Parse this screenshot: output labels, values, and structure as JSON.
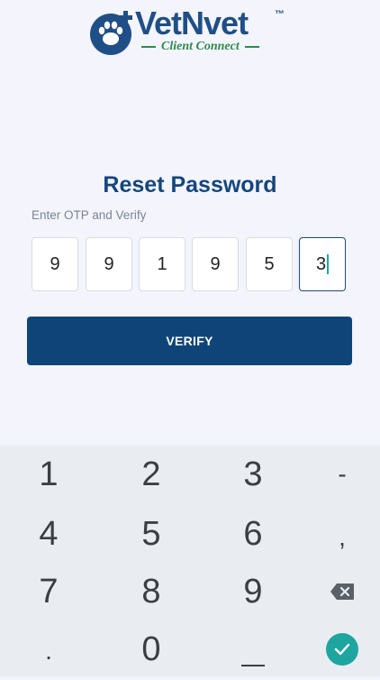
{
  "logo": {
    "brand": "VetNvet",
    "tm": "™",
    "tagline": "Client Connect",
    "mark_icon": "paw-plus-icon",
    "brand_color": "#1f4f86",
    "tagline_color": "#2f8a4c"
  },
  "screen": {
    "title": "Reset Password",
    "subtitle": "Enter OTP and Verify"
  },
  "otp": {
    "digits": [
      "9",
      "9",
      "1",
      "9",
      "5",
      "3"
    ],
    "active_index": 5
  },
  "actions": {
    "verify_label": "VERIFY",
    "verify_color": "#0f4478"
  },
  "keyboard": {
    "rows": [
      [
        "1",
        "2",
        "3",
        "-"
      ],
      [
        "4",
        "5",
        "6",
        ","
      ],
      [
        "7",
        "8",
        "9",
        "backspace"
      ],
      [
        ".",
        "0",
        "_",
        "done"
      ]
    ],
    "row1": {
      "k1": "1",
      "k2": "2",
      "k3": "3",
      "k4": "-"
    },
    "row2": {
      "k1": "4",
      "k2": "5",
      "k3": "6",
      "k4": ","
    },
    "row3": {
      "k1": "7",
      "k2": "8",
      "k3": "9"
    },
    "row4": {
      "k1": ".",
      "k2": "0"
    },
    "backspace_icon": "backspace-icon",
    "done_icon": "checkmark-icon",
    "done_color": "#1fa5a0"
  }
}
